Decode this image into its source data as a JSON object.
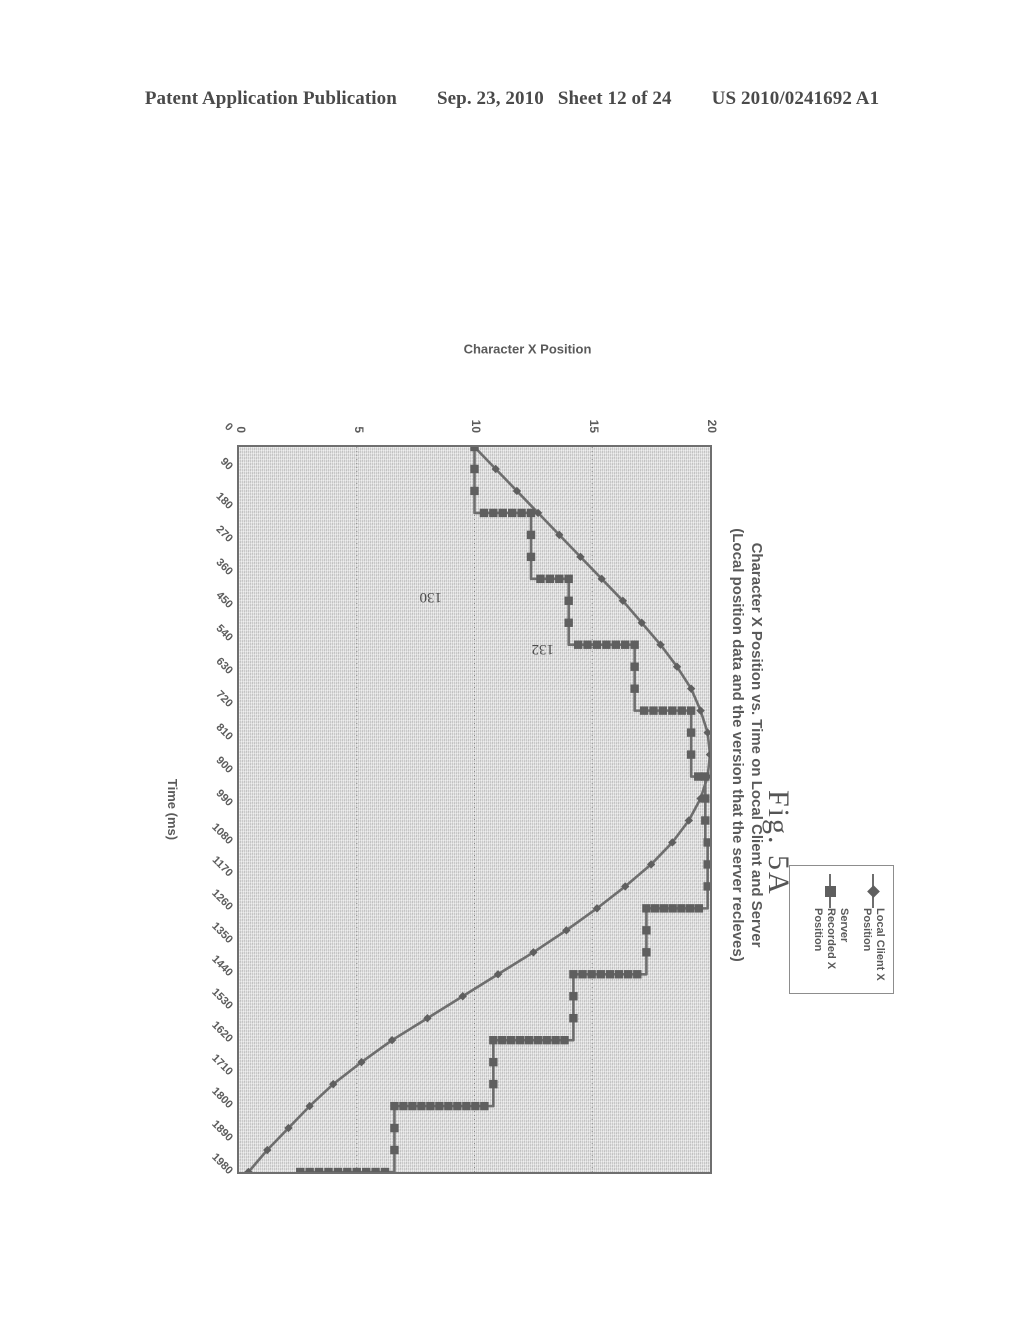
{
  "header": {
    "publication": "Patent Application Publication",
    "date": "Sep. 23, 2010",
    "sheet": "Sheet 12 of 24",
    "number": "US 2010/0241692 A1"
  },
  "figure": {
    "label": "Fig. 5A",
    "callouts": [
      {
        "id": "132",
        "text": "132"
      },
      {
        "id": "130",
        "text": "130"
      }
    ]
  },
  "legend": {
    "items": [
      {
        "label": "Local Client X Position",
        "marker": "diamond",
        "color": "#5f5f5f"
      },
      {
        "label": "Server Recorded X Position",
        "marker": "square",
        "color": "#5f5f5f"
      }
    ]
  },
  "chart_data": {
    "type": "line",
    "title": "Character X Position vs. Time on Local Client and Server",
    "subtitle": "(Local position data and the version that the server recleves)",
    "xlabel": "Time (ms)",
    "ylabel": "Character X Position",
    "xlim": [
      0,
      1980
    ],
    "ylim": [
      0,
      20
    ],
    "xticks": [
      0,
      90,
      180,
      270,
      360,
      450,
      540,
      630,
      720,
      810,
      900,
      990,
      1080,
      1170,
      1260,
      1350,
      1440,
      1530,
      1620,
      1710,
      1800,
      1890,
      1980
    ],
    "yticks": [
      0,
      5,
      10,
      15,
      20
    ],
    "grid": true,
    "gridlines_y": [
      5,
      10,
      15
    ],
    "legend_position": "top-right",
    "plot_background": "#d7d7d7",
    "line_color": "#6e6e6e",
    "x": [
      0,
      60,
      120,
      180,
      240,
      300,
      360,
      420,
      480,
      540,
      600,
      660,
      720,
      780,
      840,
      900,
      960,
      1020,
      1080,
      1140,
      1200,
      1260,
      1320,
      1380,
      1440,
      1500,
      1560,
      1620,
      1680,
      1740,
      1800,
      1860,
      1920,
      1980
    ],
    "series": [
      {
        "name": "Local Client X Position",
        "marker": "diamond",
        "values": [
          10.0,
          10.9,
          11.8,
          12.7,
          13.6,
          14.5,
          15.4,
          16.3,
          17.1,
          17.9,
          18.6,
          19.2,
          19.6,
          19.9,
          20.0,
          19.9,
          19.6,
          19.1,
          18.4,
          17.5,
          16.4,
          15.2,
          13.9,
          12.5,
          11.0,
          9.5,
          8.0,
          6.5,
          5.2,
          4.0,
          3.0,
          2.1,
          1.2,
          0.4
        ]
      },
      {
        "name": "Server Recorded X Position",
        "marker": "square",
        "step": true,
        "values": [
          10.0,
          10.0,
          10.0,
          12.4,
          12.4,
          12.4,
          14.0,
          14.0,
          14.0,
          16.8,
          16.8,
          16.8,
          19.2,
          19.2,
          19.2,
          19.8,
          19.8,
          19.8,
          19.9,
          19.9,
          19.9,
          17.3,
          17.3,
          17.3,
          14.2,
          14.2,
          14.2,
          10.8,
          10.8,
          10.8,
          6.6,
          6.6,
          6.6,
          2.6
        ]
      }
    ]
  }
}
